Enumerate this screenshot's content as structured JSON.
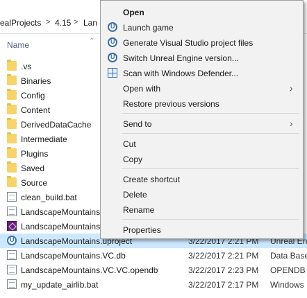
{
  "breadcrumb": {
    "items": [
      "ealProjects",
      "4.15",
      "Lan"
    ],
    "separator": ">"
  },
  "columns": {
    "name": "Name"
  },
  "files": [
    {
      "name": ".vs",
      "icon": "folder-icon"
    },
    {
      "name": "Binaries",
      "icon": "folder-icon"
    },
    {
      "name": "Config",
      "icon": "folder-icon"
    },
    {
      "name": "Content",
      "icon": "folder-icon"
    },
    {
      "name": "DerivedDataCache",
      "icon": "folder-icon"
    },
    {
      "name": "Intermediate",
      "icon": "folder-icon"
    },
    {
      "name": "Plugins",
      "icon": "folder-icon"
    },
    {
      "name": "Saved",
      "icon": "folder-icon"
    },
    {
      "name": "Source",
      "icon": "folder-icon"
    },
    {
      "name": "clean_build.bat",
      "icon": "batch-file-icon"
    },
    {
      "name": "LandscapeMountains",
      "icon": "document-icon"
    },
    {
      "name": "LandscapeMountains",
      "icon": "visual-studio-icon"
    },
    {
      "name": "LandscapeMountains.uproject",
      "icon": "unreal-engine-icon",
      "date": "3/22/2017 2:21 PM",
      "type": "Unreal En",
      "selected": true
    },
    {
      "name": "LandscapeMountains.VC.db",
      "icon": "database-file-icon",
      "date": "3/22/2017 2:21 PM",
      "type": "Data Base"
    },
    {
      "name": "LandscapeMountains.VC.VC.opendb",
      "icon": "file-icon",
      "date": "3/22/2017 2:23 PM",
      "type": "OPENDB F"
    },
    {
      "name": "my_update_airlib.bat",
      "icon": "batch-file-icon",
      "date": "3/22/2017 2:17 PM",
      "type": "Windows"
    }
  ],
  "context_menu": {
    "open": "Open",
    "launch_game": "Launch game",
    "generate_vs": "Generate Visual Studio project files",
    "switch_version": "Switch Unreal Engine version...",
    "scan_defender": "Scan with Windows Defender...",
    "open_with": "Open with",
    "restore_versions": "Restore previous versions",
    "send_to": "Send to",
    "cut": "Cut",
    "copy": "Copy",
    "create_shortcut": "Create shortcut",
    "delete": "Delete",
    "rename": "Rename",
    "properties": "Properties"
  },
  "colors": {
    "selection": "#cce8ff",
    "menu_bg": "#f2f2f2",
    "folder": "#f6d46a",
    "ue_blue": "#3b6ea8"
  }
}
